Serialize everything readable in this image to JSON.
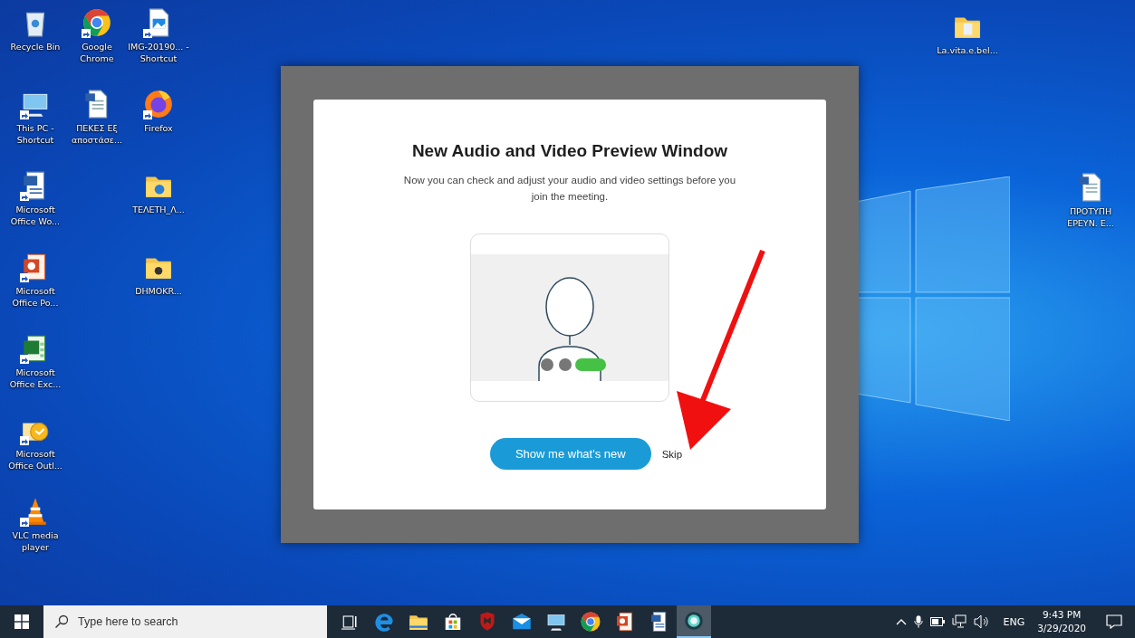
{
  "desktop_icons": [
    {
      "label": "Recycle Bin",
      "kind": "recycle",
      "shortcut": false
    },
    {
      "label": "Google Chrome",
      "kind": "chrome",
      "shortcut": true
    },
    {
      "label": "IMG-20190... - Shortcut",
      "kind": "image",
      "shortcut": true
    },
    {
      "label": "This PC - Shortcut",
      "kind": "pc",
      "shortcut": true
    },
    {
      "label": "ΠΕΚΕΣ Εξ αποστάσε...",
      "kind": "doc",
      "shortcut": false
    },
    {
      "label": "Firefox",
      "kind": "firefox",
      "shortcut": true
    },
    {
      "label": "Microsoft Office Wo...",
      "kind": "word",
      "shortcut": true
    },
    {
      "label": "ΤΕΛΕΤΗ_Λ...",
      "kind": "folder-edge",
      "shortcut": false
    },
    {
      "label": "Microsoft Office Po...",
      "kind": "ppt",
      "shortcut": true
    },
    {
      "label": "DHMOKR...",
      "kind": "folder-media",
      "shortcut": false
    },
    {
      "label": "Microsoft Office Exc...",
      "kind": "excel",
      "shortcut": true
    },
    {
      "label": "Microsoft Office Outl...",
      "kind": "outlook",
      "shortcut": true
    },
    {
      "label": "VLC media player",
      "kind": "vlc",
      "shortcut": true
    },
    {
      "label": "La.vita.e.bel...",
      "kind": "folder-photo",
      "shortcut": false
    },
    {
      "label": "ΠΡΟΤΥΠΗ ΕΡΕΥΝ. Ε...",
      "kind": "doc",
      "shortcut": false
    }
  ],
  "dialog": {
    "title": "New Audio and Video Preview Window",
    "description": "Now you can check and adjust your audio and video settings before you join the meeting.",
    "primary_button": "Show me what's new",
    "skip_link": "Skip"
  },
  "taskbar": {
    "search": {
      "placeholder": "Type here to search"
    },
    "pinned": [
      {
        "kind": "taskview",
        "active": false
      },
      {
        "kind": "edge",
        "active": false
      },
      {
        "kind": "explorer",
        "active": false
      },
      {
        "kind": "store",
        "active": false
      },
      {
        "kind": "mcafee",
        "active": false
      },
      {
        "kind": "mail",
        "active": false
      },
      {
        "kind": "pc",
        "active": false
      },
      {
        "kind": "chrome",
        "active": false
      },
      {
        "kind": "ppt",
        "active": false
      },
      {
        "kind": "word",
        "active": false
      },
      {
        "kind": "webex",
        "active": true
      }
    ],
    "language": "ENG",
    "time": "9:43 PM",
    "date": "3/29/2020"
  }
}
